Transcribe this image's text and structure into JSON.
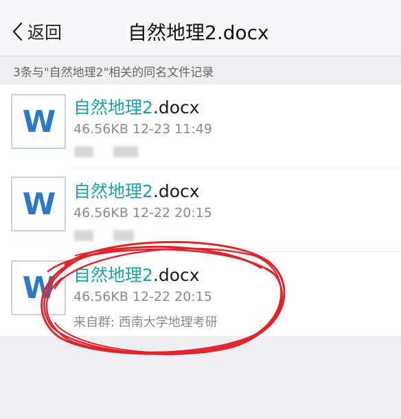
{
  "header": {
    "back_label": "返回",
    "title": "自然地理2.docx"
  },
  "subheader": {
    "text": "3条与\"自然地理2\"相关的同名文件记录"
  },
  "files": [
    {
      "icon_letter": "W",
      "name_highlight": "自然地理2",
      "name_rest": ".docx",
      "meta": "46.56KB 12-23 11:49"
    },
    {
      "icon_letter": "W",
      "name_highlight": "自然地理2",
      "name_rest": ".docx",
      "meta": "46.56KB 12-22 20:15"
    },
    {
      "icon_letter": "W",
      "name_highlight": "自然地理2",
      "name_rest": ".docx",
      "meta": "46.56KB 12-22 20:15",
      "source": "来自群: 西南大学地理考研"
    }
  ],
  "colors": {
    "highlight": "#1aa3a0",
    "word_icon": "#2c79c7",
    "annotation": "#e0242b"
  }
}
